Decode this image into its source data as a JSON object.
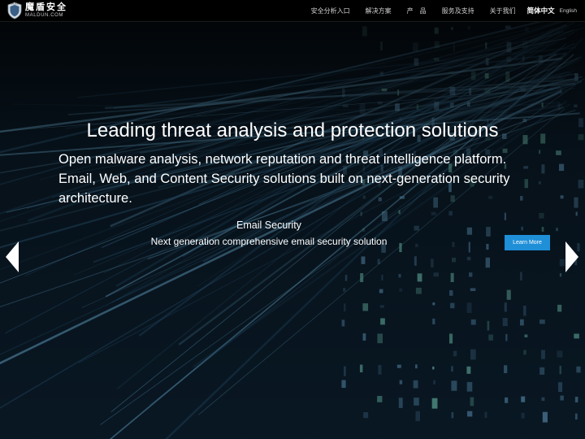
{
  "brand": {
    "logo_badge": "MALDUN",
    "name_cn": "魔盾安全",
    "name_en": "MALDUN.COM"
  },
  "nav": {
    "items": [
      {
        "label": "安全分析入口"
      },
      {
        "label": "解决方案"
      },
      {
        "label": "产　品"
      },
      {
        "label": "服务及支持"
      },
      {
        "label": "关于我们"
      }
    ],
    "lang_current": "简体中文",
    "lang_alt": "English"
  },
  "hero": {
    "title": "Leading threat analysis and protection solutions",
    "description": "Open malware analysis, network reputation and threat intelligence platform. Email, Web, and Content Security solutions built on next-generation security architecture."
  },
  "slide": {
    "title": "Email Security",
    "subtitle": "Next generation comprehensive email security solution",
    "cta_label": "Learn More"
  },
  "carousel": {
    "prev_icon": "chevron-left-icon",
    "next_icon": "chevron-right-icon"
  },
  "colors": {
    "accent": "#1f8fd8",
    "topbar": "#000000",
    "text": "#ffffff"
  }
}
